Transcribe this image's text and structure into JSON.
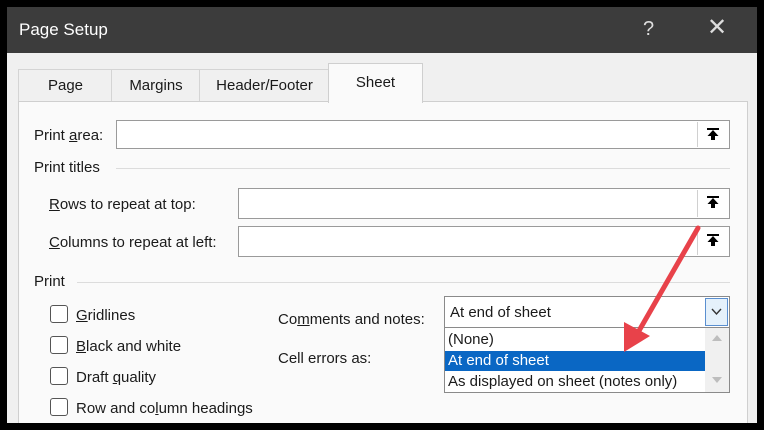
{
  "window": {
    "title": "Page Setup",
    "help_icon": "question-mark",
    "close_icon": "close-x"
  },
  "tabs": [
    {
      "label": "Page",
      "active": false
    },
    {
      "label": "Margins",
      "active": false
    },
    {
      "label": "Header/Footer",
      "active": false
    },
    {
      "label": "Sheet",
      "active": true
    }
  ],
  "print_area": {
    "label_pre": "Print ",
    "label_ul": "a",
    "label_post": "rea:",
    "value": ""
  },
  "print_titles": {
    "heading": "Print titles",
    "rows": {
      "label_ul": "R",
      "label_post": "ows to repeat at top:",
      "value": ""
    },
    "columns": {
      "label_ul": "C",
      "label_post": "olumns to repeat at left:",
      "value": ""
    }
  },
  "print": {
    "heading": "Print",
    "checkboxes": [
      {
        "ul": "G",
        "rest": "ridlines",
        "pre": "",
        "checked": false
      },
      {
        "ul": "B",
        "rest": "lack and white",
        "pre": "",
        "checked": false
      },
      {
        "pre": "Draft ",
        "ul": "q",
        "rest": "uality",
        "checked": false
      },
      {
        "pre": "Row and co",
        "ul": "l",
        "rest": "umn headings",
        "checked": false
      }
    ],
    "comments_label_pre": "Co",
    "comments_label_ul": "m",
    "comments_label_post": "ments and notes:",
    "comments_value": "At end of sheet",
    "cell_errors_label": "Cell errors as:",
    "dropdown_options": [
      "(None)",
      "At end of sheet",
      "As displayed on sheet (notes only)"
    ],
    "dropdown_selected": "At end of sheet"
  },
  "colors": {
    "titlebar": "#3c3c3c",
    "selection": "#0a67c4",
    "annotation_arrow": "#e8424a"
  },
  "icons": [
    "collapse-dialog-icon",
    "chevron-down-icon",
    "scroll-up-icon",
    "scroll-down-icon",
    "annotation-arrow"
  ]
}
